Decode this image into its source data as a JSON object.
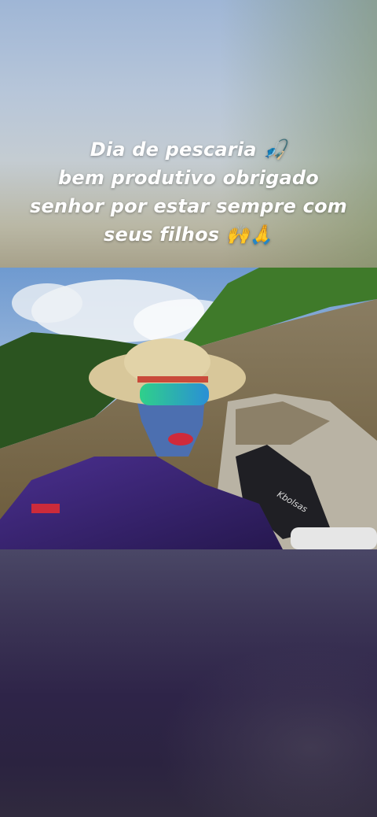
{
  "caption": {
    "line1": "Dia de pescaria 🎣",
    "line2": "bem produtivo obrigado",
    "line3": "senhor por estar sempre com",
    "line4": "seus filhos 🙌🙏"
  },
  "photo": {
    "bag_brand": "Kbolsas"
  },
  "colors": {
    "sky": "#9fb6d6",
    "river": "#7a6a48",
    "jungle": "#2f5a22",
    "shirt": "#3b2a7a",
    "hat": "#d8c79a",
    "mask": "#4c6fb0"
  }
}
